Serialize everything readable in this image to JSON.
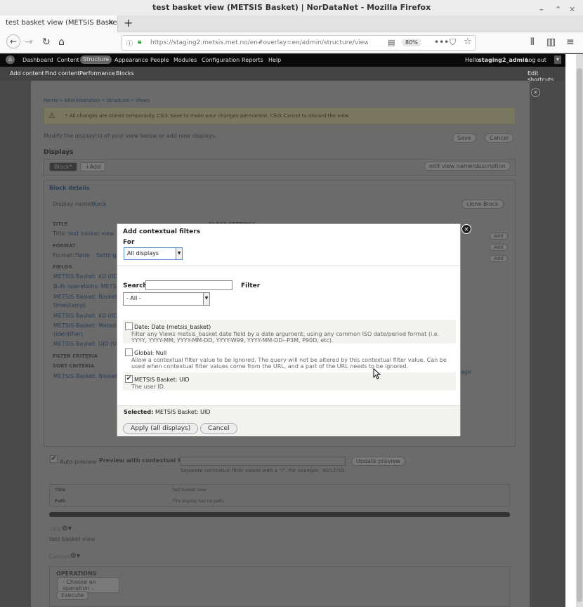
{
  "window": {
    "title": "test basket view (METSIS Basket) | NorDataNet - Mozilla Firefox"
  },
  "tab": {
    "label": "test basket view (METSIS Basket"
  },
  "browser": {
    "url": "https://staging2.metsis.met.no/en#overlay=en/admin/structure/views/view",
    "zoom": "80%"
  },
  "admin_menu": {
    "dashboard": "Dashboard",
    "content": "Content",
    "structure": "Structure",
    "appearance": "Appearance",
    "people": "People",
    "modules": "Modules",
    "configuration": "Configuration",
    "reports": "Reports",
    "help": "Help",
    "hello": "Hello",
    "user": "staging2_admin",
    "logout": "Log out"
  },
  "shortcuts": {
    "add_content": "Add content",
    "find_content": "Find content",
    "performance": "Performance",
    "blocks": "Blocks",
    "edit": "Edit shortcuts"
  },
  "background": {
    "breadcrumb": "Home » Administration » Structure » Views",
    "warning": "* All changes are stored temporarily. Click Save to make your changes permanent. Click Cancel to discard the view",
    "modify_text": "Modify the display(s) of your view below or add new displays.",
    "save": "Save",
    "cancel": "Cancel",
    "displays": "Displays",
    "block_tab": "Block*",
    "add": "+Add",
    "edit_view_name": "edit view name/description",
    "block_details": "Block details",
    "display_name_label": "Display name:",
    "display_name": "Block",
    "clone": "clone Block",
    "title_head": "TITLE",
    "title_label": "Title:",
    "title_value": "test basket view",
    "block_settings": "BLOCK SETTINGS",
    "format_head": "FORMAT",
    "format_label": "Format:",
    "format_value": "Table",
    "settings": "Settings",
    "fields_head": "FIELDS",
    "fields": [
      "METSIS Basket: IID (IID)",
      "Bulk operations: METSIS",
      "METSIS Basket: Basket t",
      "timestamp)",
      "METSIS Basket: IID (IID)",
      "METSIS Basket: Metadat",
      "(identifier)",
      "METSIS Basket: UID (UID"
    ],
    "filter_head": "FILTER CRITERIA",
    "sort_head": "SORT CRITERIA",
    "sort_item": "METSIS Basket: Basket t",
    "add_small": "Add",
    "age": "age",
    "auto_preview": "Auto preview",
    "preview_label": "Preview with contextual filters:",
    "update_preview": "Update preview",
    "preview_hint": "Separate contextual filter values with a \"/\". For example, 40/12/10.",
    "title_row": "Title",
    "title_row_val": "test basket view",
    "path_row": "Path",
    "path_row_val": "This display has no path.",
    "title_section": "Title",
    "title_section_value": "test basket view",
    "content_section": "Content",
    "operations": "OPERATIONS",
    "choose_operation": "- Choose an operation -",
    "execute": "Execute"
  },
  "modal": {
    "title": "Add contextual filters",
    "for_label": "For",
    "for_value": "All displays",
    "search_label": "Search",
    "search_value": "",
    "filter_label": "Filter",
    "filter_value": "- All -",
    "items": [
      {
        "title": "Date: Date (metsis_basket)",
        "desc": "Filter any Views metsis_basket date field by a date argument, using any common ISO date/period format (i.e. YYYY, YYYY-MM, YYYY-MM-DD, YYYY-W99, YYYY-MM-DD--P3M, P90D, etc).",
        "checked": false
      },
      {
        "title": "Global: Null",
        "desc": "Allow a contextual filter value to be ignored. The query will not be altered by this contextual filter value. Can be used when contextual filter values come from the URL, and a part of the URL needs to be ignored.",
        "checked": true
      },
      {
        "title": "METSIS Basket: UID",
        "desc": "The user ID.",
        "checked": true
      }
    ],
    "selected_label": "Selected:",
    "selected_value": "METSIS Basket: UID",
    "apply": "Apply (all displays)",
    "cancel": "Cancel",
    "check_glyph": "✔"
  }
}
